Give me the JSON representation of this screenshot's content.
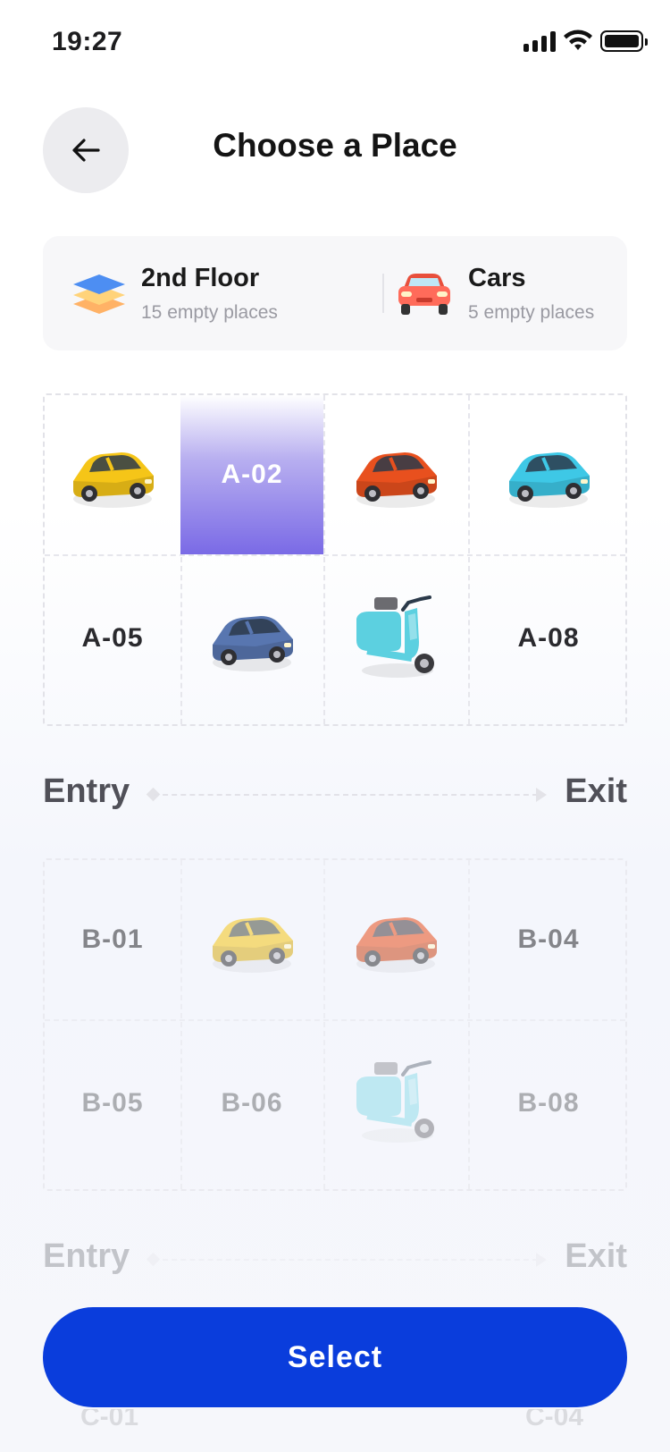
{
  "status": {
    "time": "19:27"
  },
  "header": {
    "title": "Choose a Place",
    "back_icon": "arrow-left-icon"
  },
  "info": {
    "floor": {
      "title": "2nd Floor",
      "subtitle": "15 empty places",
      "icon": "layers-icon"
    },
    "vehicle": {
      "title": "Cars",
      "subtitle": "5 empty places",
      "icon": "car-icon"
    }
  },
  "sectionA": {
    "row1": [
      {
        "type": "car",
        "color": "#f5c518"
      },
      {
        "type": "spot",
        "label": "A-02",
        "selected": true
      },
      {
        "type": "car",
        "color": "#e8501e"
      },
      {
        "type": "car",
        "color": "#3ec8e6"
      }
    ],
    "row2": [
      {
        "type": "spot",
        "label": "A-05"
      },
      {
        "type": "car",
        "color": "#5876b0"
      },
      {
        "type": "scooter",
        "color": "#5cd0e0"
      },
      {
        "type": "spot",
        "label": "A-08"
      }
    ]
  },
  "road1": {
    "entry": "Entry",
    "exit": "Exit"
  },
  "sectionB": {
    "row1": [
      {
        "type": "spot",
        "label": "B-01"
      },
      {
        "type": "car",
        "color": "#f5c518"
      },
      {
        "type": "car",
        "color": "#e8501e"
      },
      {
        "type": "spot",
        "label": "B-04"
      }
    ],
    "row2": [
      {
        "type": "spot",
        "label": "B-05"
      },
      {
        "type": "spot",
        "label": "B-06"
      },
      {
        "type": "scooter",
        "color": "#5cd0e0"
      },
      {
        "type": "spot",
        "label": "B-08"
      }
    ]
  },
  "road2": {
    "entry": "Entry",
    "exit": "Exit"
  },
  "cta": {
    "label": "Select"
  },
  "ghost": {
    "left": "C-01",
    "right": "C-04"
  },
  "colors": {
    "accent": "#0a3ddc",
    "selected": "#7a6ae6"
  }
}
